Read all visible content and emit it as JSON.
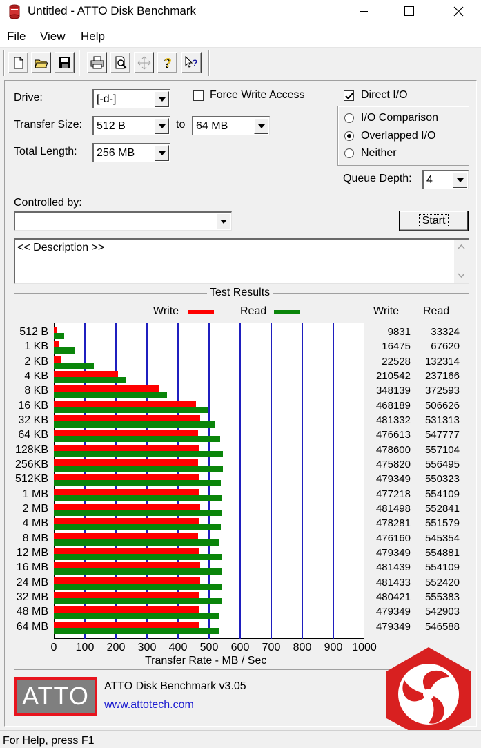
{
  "window": {
    "title": "Untitled - ATTO Disk Benchmark",
    "minimize_icon": "minimize-icon",
    "maximize_icon": "maximize-icon",
    "close_icon": "close-icon"
  },
  "menu": [
    "File",
    "View",
    "Help"
  ],
  "toolbar": [
    "new-file-icon",
    "open-folder-icon",
    "save-icon",
    "print-icon",
    "print-preview-icon",
    "move-icon",
    "help-icon",
    "context-help-icon"
  ],
  "settings": {
    "drive_label": "Drive:",
    "drive_value": "[-d-]",
    "force_write_label": "Force Write Access",
    "force_write_checked": false,
    "direct_io_label": "Direct I/O",
    "direct_io_checked": true,
    "transfer_size_label": "Transfer Size:",
    "transfer_from": "512 B",
    "to_label": "to",
    "transfer_to": "64 MB",
    "total_length_label": "Total Length:",
    "total_length_value": "256 MB",
    "io_options": [
      {
        "label": "I/O Comparison",
        "selected": false
      },
      {
        "label": "Overlapped I/O",
        "selected": true
      },
      {
        "label": "Neither",
        "selected": false
      }
    ],
    "queue_depth_label": "Queue Depth:",
    "queue_depth_value": "4",
    "controlled_by_label": "Controlled by:",
    "controlled_by_value": "",
    "start_label": "Start",
    "description": "<< Description >>"
  },
  "results": {
    "title": "Test Results",
    "legend_write": "Write",
    "legend_read": "Read",
    "col_write": "Write",
    "col_read": "Read",
    "xlabel": "Transfer Rate - MB / Sec"
  },
  "chart_data": {
    "type": "bar",
    "orientation": "horizontal",
    "categories": [
      "512 B",
      "1 KB",
      "2 KB",
      "4 KB",
      "8 KB",
      "16 KB",
      "32 KB",
      "64 KB",
      "128KB",
      "256KB",
      "512KB",
      "1 MB",
      "2 MB",
      "4 MB",
      "8 MB",
      "12 MB",
      "16 MB",
      "24 MB",
      "32 MB",
      "48 MB",
      "64 MB"
    ],
    "series": [
      {
        "name": "Write",
        "color": "#ff0000",
        "values": [
          9831,
          16475,
          22528,
          210542,
          348139,
          468189,
          481332,
          476613,
          478600,
          475820,
          479349,
          477218,
          481498,
          478281,
          476160,
          479349,
          481439,
          481433,
          480421,
          479349,
          479349
        ]
      },
      {
        "name": "Read",
        "color": "#0a850a",
        "values": [
          33324,
          67620,
          132314,
          237166,
          372593,
          506626,
          531313,
          547777,
          557104,
          556495,
          550323,
          554109,
          552841,
          551579,
          545354,
          554881,
          554109,
          552420,
          555383,
          542903,
          546588
        ]
      }
    ],
    "xlabel": "Transfer Rate - MB / Sec",
    "xlim": [
      0,
      1000
    ],
    "xticks": [
      "0",
      "100",
      "200",
      "300",
      "400",
      "500",
      "600",
      "700",
      "800",
      "900",
      "1000"
    ],
    "value_unit_divisor": 1024
  },
  "footer": {
    "logo_text": "ATTO",
    "product": "ATTO Disk Benchmark v3.05",
    "url": "www.attotech.com",
    "watermark_icon": "kitguru-logo-icon"
  },
  "status": {
    "text": "For Help, press F1"
  }
}
